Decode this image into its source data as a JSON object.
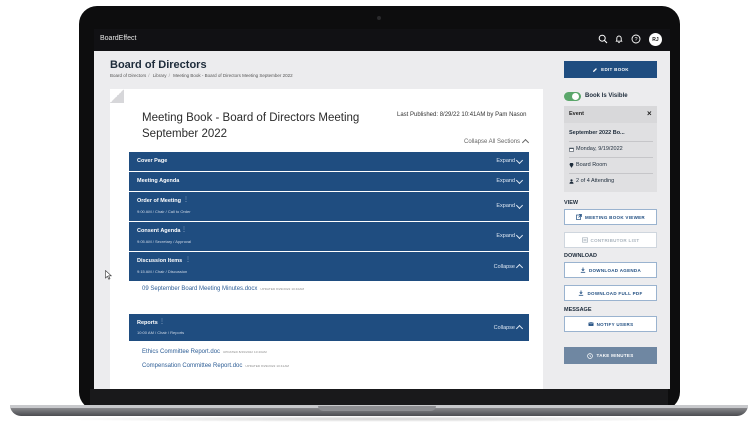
{
  "app": {
    "brand": "BoardEffect",
    "avatar_initials": "RJ"
  },
  "header": {
    "title": "Board of Directors",
    "breadcrumb": [
      "Board of Directors",
      "Library",
      "Meeting Book - Board of Directors Meeting September 2022"
    ]
  },
  "meeting_book": {
    "title": "Meeting Book - Board of Directors Meeting September 2022",
    "last_published": "Last Published: 8/29/22 10:41AM by Pam Nason",
    "collapse_all": "Collapse All Sections"
  },
  "sections": [
    {
      "name": "Cover Page",
      "sub": "",
      "toggle": "Expand"
    },
    {
      "name": "Meeting Agenda",
      "sub": "",
      "toggle": "Expand"
    },
    {
      "name": "Order of Meeting",
      "sub": "9:00 AM / Chair / Call to Order",
      "toggle": "Expand"
    },
    {
      "name": "Consent Agenda",
      "sub": "9:05 AM / Secretary / Approval",
      "toggle": "Expand"
    },
    {
      "name": "Discussion Items",
      "sub": "9:15 AM / Chair / Discussion",
      "toggle": "Collapse"
    },
    {
      "name": "Reports",
      "sub": "10:00 AM / Chair / Reports",
      "toggle": "Collapse"
    }
  ],
  "documents": {
    "discussion": [
      {
        "name": "09 September Board Meeting Minutes.docx",
        "meta": "UPDATED 8/29/2022 10:40AM"
      }
    ],
    "reports": [
      {
        "name": "Ethics Committee Report.doc",
        "meta": "UPDATED 8/29/2022 10:40AM"
      },
      {
        "name": "Compensation Committee Report.doc",
        "meta": "UPDATED 8/29/2022 10:41AM"
      }
    ]
  },
  "sidebar": {
    "edit_book": "EDIT BOOK",
    "visibility_label": "Book Is Visible",
    "visibility_on": true,
    "event": {
      "label": "Event",
      "name": "September 2022 Bo...",
      "date": "Monday, 9/19/2022",
      "location": "Board Room",
      "attending": "2 of 4 Attending"
    },
    "view_heading": "VIEW",
    "meeting_book_viewer": "MEETING BOOK VIEWER",
    "contributor_list": "CONTRIBUTOR LIST",
    "download_heading": "DOWNLOAD",
    "download_agenda": "DOWNLOAD AGENDA",
    "download_full_pdf": "DOWNLOAD FULL PDF",
    "message_heading": "MESSAGE",
    "notify_users": "NOTIFY USERS",
    "take_minutes": "TAKE MINUTES"
  },
  "colors": {
    "primary": "#1f4d80",
    "topbar": "#111114",
    "toggle_on": "#5aa66a"
  },
  "icons": [
    "search-icon",
    "bell-icon",
    "help-icon",
    "pencil-icon",
    "calendar-icon",
    "map-pin-icon",
    "users-icon",
    "external-link-icon",
    "download-icon",
    "envelope-icon",
    "clock-icon"
  ]
}
